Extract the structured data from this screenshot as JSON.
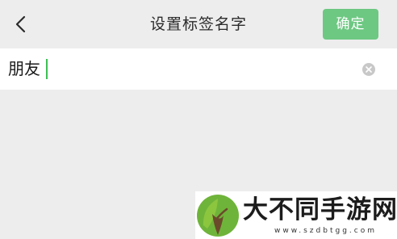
{
  "header": {
    "title": "设置标签名字",
    "confirm_label": "确定",
    "back_icon": "chevron-left-icon"
  },
  "input": {
    "value": "朋友",
    "clear_icon": "clear-circle-icon"
  },
  "watermark": {
    "name": "大不同手游网",
    "url": "www.szdbtgg.com"
  },
  "colors": {
    "background": "#ededed",
    "accent": "#6dc882",
    "caret": "#3dbf55"
  }
}
